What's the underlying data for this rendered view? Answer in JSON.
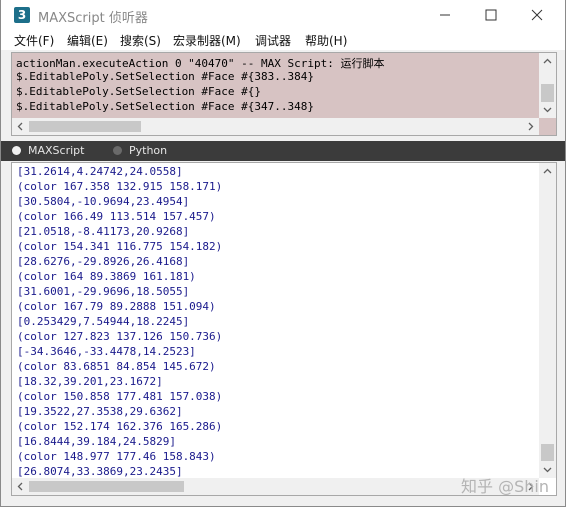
{
  "window": {
    "app_icon_glyph": "3",
    "title": "MAXScript 侦听器"
  },
  "menu": [
    "文件(F)",
    "编辑(E)",
    "搜索(S)",
    "宏录制器(M)",
    "调试器",
    "帮助(H)"
  ],
  "macro_recorder": {
    "lines": [
      "actionMan.executeAction 0 \"40470\"  -- MAX Script: 运行脚本",
      "$.EditablePoly.SetSelection #Face #{383..384}",
      "$.EditablePoly.SetSelection #Face #{}",
      "$.EditablePoly.SetSelection #Face #{347..348}"
    ]
  },
  "language": {
    "options": [
      "MAXScript",
      "Python"
    ],
    "selected": "MAXScript"
  },
  "output": {
    "lines": [
      "[31.2614,4.24742,24.0558]",
      "(color 167.358 132.915 158.171)",
      "[30.5804,-10.9694,23.4954]",
      "(color 166.49 113.514 157.457)",
      "[21.0518,-8.41173,20.9268]",
      "(color 154.341 116.775 154.182)",
      "[28.6276,-29.8926,26.4168]",
      "(color 164 89.3869 161.181)",
      "[31.6001,-29.9696,18.5055]",
      "(color 167.79 89.2888 151.094)",
      "[0.253429,7.54944,18.2245]",
      "(color 127.823 137.126 150.736)",
      "[-34.3646,-33.4478,14.2523]",
      "(color 83.6851 84.854 145.672)",
      "[18.32,39.201,23.1672]",
      "(color 150.858 177.481 157.038)",
      "[19.3522,27.3538,29.6362]",
      "(color 152.174 162.376 165.286)",
      "[16.8444,39.184,24.5829]",
      "(color 148.977 177.46 158.843)",
      "[26.8074,33.3869,23.2435]"
    ]
  },
  "watermark": "知乎 @Shin",
  "colors": {
    "macro_bg": "#d7c3c3",
    "output_text": "#1a1a8c",
    "lang_bar_bg": "#3b3b3b"
  }
}
